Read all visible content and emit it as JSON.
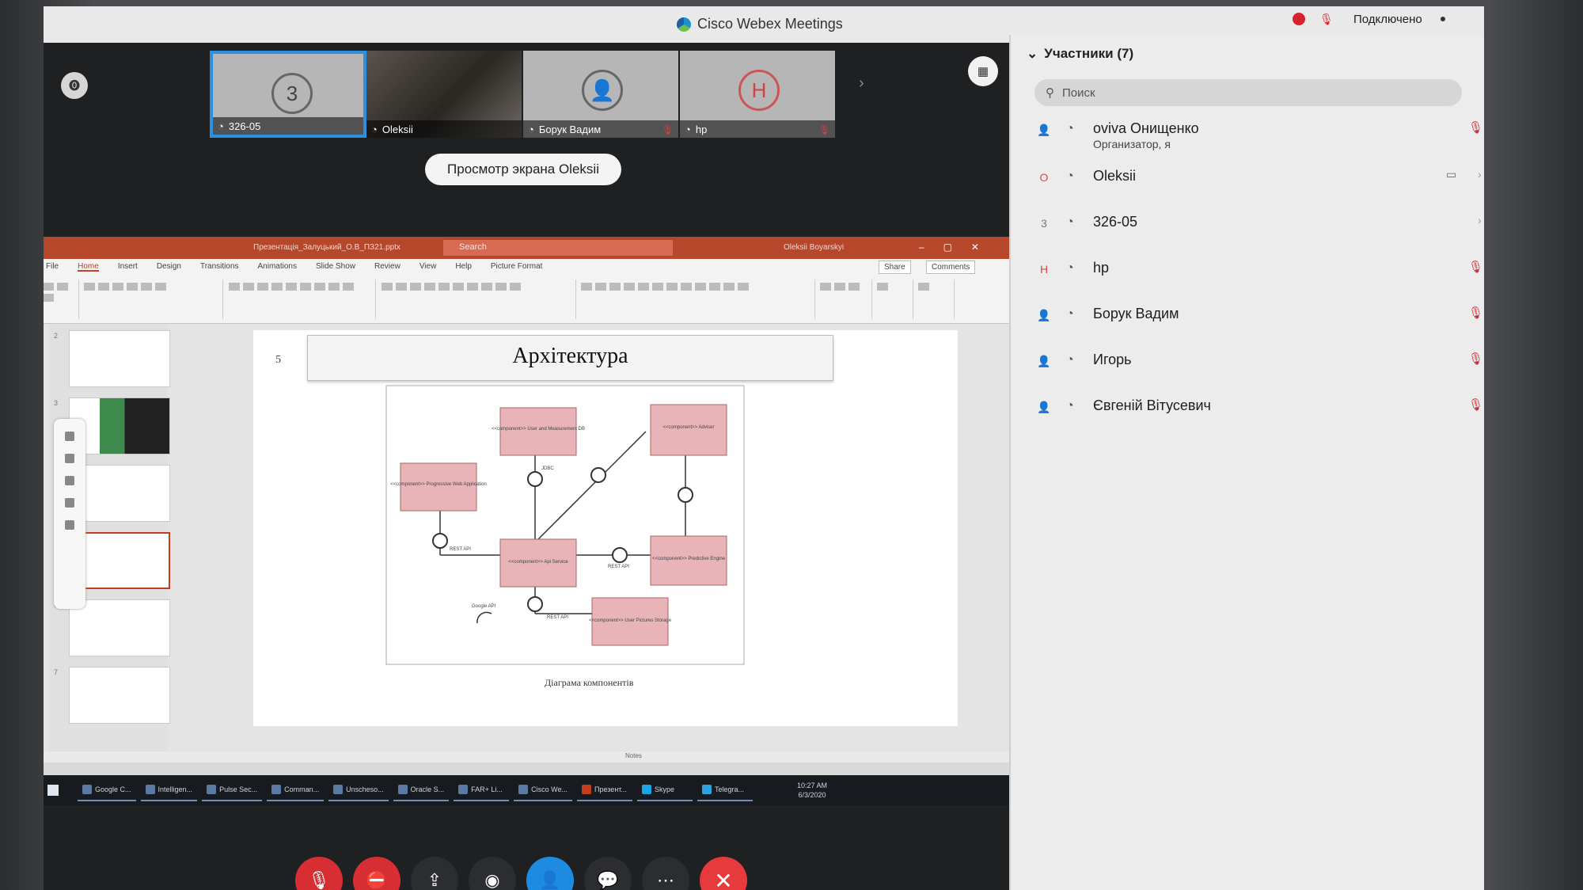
{
  "app": {
    "title": "Cisco Webex Meetings",
    "status": "Подключено"
  },
  "thumbnails": [
    {
      "initial": "3",
      "name": "326-05",
      "active": true,
      "muted": false
    },
    {
      "initial": "",
      "name": "Oleksii",
      "video": true,
      "muted": false
    },
    {
      "initial": "",
      "name": "Борук Вадим",
      "muted": true
    },
    {
      "initial": "H",
      "name": "hp",
      "muted": true
    }
  ],
  "viewing_label": "Просмотр экрана Oleksii",
  "ppt": {
    "filename": "Презентація_Залуцький_О.В_ПЗ21.pptx",
    "search": "Search",
    "user": "Oleksii Boyarskyi",
    "menu": [
      "File",
      "Home",
      "Insert",
      "Design",
      "Transitions",
      "Animations",
      "Slide Show",
      "Review",
      "View",
      "Help",
      "Picture Format"
    ],
    "share": "Share",
    "comments": "Comments",
    "slide_number": "5",
    "slide_title": "Архітектура",
    "diagram_caption": "Діаграма компонентів",
    "notes": "Notes",
    "diagram_labels": {
      "pwa": "<<component>> Progressive Web Application",
      "userdb": "<<component>> User and Measurement DB",
      "adviser": "<<component>> Adviser",
      "api": "<<component>> Api Service",
      "predict": "<<component>> Predictive Engine",
      "storage": "<<component>> User Pictures Storage",
      "rest1": "REST API",
      "rest2": "REST API",
      "rest3": "REST API",
      "jdbc": "JDBC",
      "google": "Google API"
    }
  },
  "taskbar": [
    {
      "label": "Google C..."
    },
    {
      "label": "Intelligen..."
    },
    {
      "label": "Pulse Sec..."
    },
    {
      "label": "Comman..."
    },
    {
      "label": "Unscheso..."
    },
    {
      "label": "Oracle S..."
    },
    {
      "label": "FAR+ Li..."
    },
    {
      "label": "Cisco We..."
    },
    {
      "label": "Презент..."
    },
    {
      "label": "Skype"
    },
    {
      "label": "Telegra..."
    }
  ],
  "clock": {
    "time": "10:27 AM",
    "date": "6/3/2020"
  },
  "panel": {
    "title": "Участники (7)",
    "search_placeholder": "Поиск",
    "participants": [
      {
        "initial": "",
        "name": "oviva Онищенко",
        "role": "Организатор, я",
        "muted": true
      },
      {
        "initial": "O",
        "name": "Oleksii",
        "role": "",
        "muted": false,
        "camera": true
      },
      {
        "initial": "3",
        "name": "326-05",
        "role": "",
        "muted": false
      },
      {
        "initial": "H",
        "name": "hp",
        "role": "",
        "muted": true
      },
      {
        "initial": "",
        "name": "Борук Вадим",
        "role": "",
        "muted": true
      },
      {
        "initial": "",
        "name": "Игорь",
        "role": "",
        "muted": true
      },
      {
        "initial": "",
        "name": "Євгеній Вітусевич",
        "role": "",
        "muted": true
      }
    ]
  },
  "colors": {
    "accent": "#1d8ce0",
    "danger": "#d62e32",
    "ppt": "#b7472a"
  }
}
